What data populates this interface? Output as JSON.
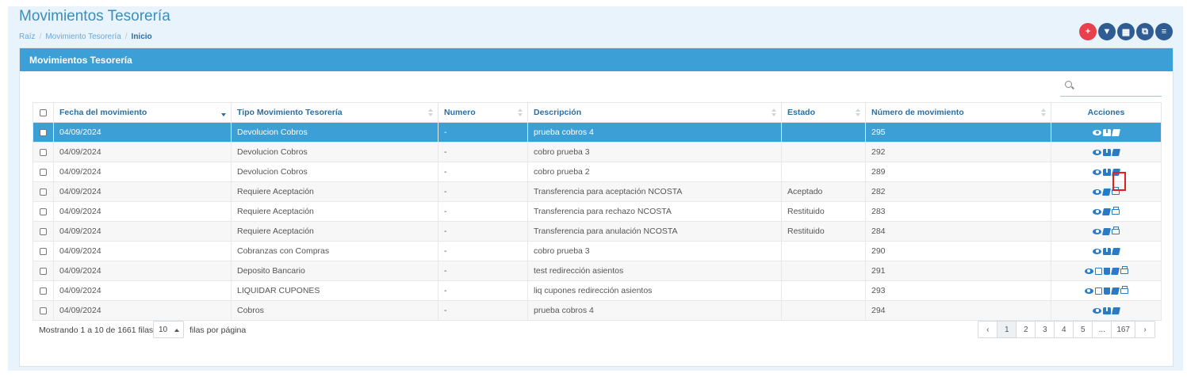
{
  "header": {
    "title": "Movimientos Tesorería",
    "breadcrumb": [
      "Raíz",
      "Movimiento Tesorería",
      "Inicio"
    ]
  },
  "toolbar": {
    "buttons": [
      {
        "icon": "plus-icon",
        "glyph": "+",
        "color": "#e8414d"
      },
      {
        "icon": "filter-icon",
        "glyph": "▼",
        "color": "#2f5d93"
      },
      {
        "icon": "columns-icon",
        "glyph": "▦",
        "color": "#2f5d93"
      },
      {
        "icon": "copy-icon",
        "glyph": "⧉",
        "color": "#2f5d93"
      },
      {
        "icon": "menu-icon",
        "glyph": "≡",
        "color": "#2f5d93"
      }
    ]
  },
  "panel": {
    "title": "Movimientos Tesorería",
    "search_placeholder": ""
  },
  "table": {
    "columns": [
      "Fecha del movimiento",
      "Tipo Movimiento Tesorería",
      "Numero",
      "Descripción",
      "Estado",
      "Número de movimiento",
      "Acciones"
    ],
    "rows": [
      {
        "fecha": "04/09/2024",
        "tipo": "Devolucion Cobros",
        "numero": "-",
        "descripcion": "prueba cobros 4",
        "estado": "",
        "nro": "295",
        "actions": [
          "eye",
          "binoculars",
          "book"
        ],
        "selected": true
      },
      {
        "fecha": "04/09/2024",
        "tipo": "Devolucion Cobros",
        "numero": "-",
        "descripcion": "cobro prueba 3",
        "estado": "",
        "nro": "292",
        "actions": [
          "eye",
          "binoculars",
          "book"
        ]
      },
      {
        "fecha": "04/09/2024",
        "tipo": "Devolucion Cobros",
        "numero": "-",
        "descripcion": "cobro prueba 2",
        "estado": "",
        "nro": "289",
        "actions": [
          "eye",
          "binoculars",
          "book"
        ]
      },
      {
        "fecha": "04/09/2024",
        "tipo": "Requiere Aceptación",
        "numero": "-",
        "descripcion": "Transferencia para aceptación NCOSTA",
        "estado": "Aceptado",
        "nro": "282",
        "actions": [
          "eye",
          "book",
          "print"
        ]
      },
      {
        "fecha": "04/09/2024",
        "tipo": "Requiere Aceptación",
        "numero": "-",
        "descripcion": "Transferencia para rechazo NCOSTA",
        "estado": "Restituido",
        "nro": "283",
        "actions": [
          "eye",
          "book",
          "print"
        ]
      },
      {
        "fecha": "04/09/2024",
        "tipo": "Requiere Aceptación",
        "numero": "-",
        "descripcion": "Transferencia para anulación NCOSTA",
        "estado": "Restituido",
        "nro": "284",
        "actions": [
          "eye",
          "book",
          "print"
        ]
      },
      {
        "fecha": "04/09/2024",
        "tipo": "Cobranzas con Compras",
        "numero": "-",
        "descripcion": "cobro prueba 3",
        "estado": "",
        "nro": "290",
        "actions": [
          "eye",
          "binoculars",
          "book"
        ]
      },
      {
        "fecha": "04/09/2024",
        "tipo": "Deposito Bancario",
        "numero": "-",
        "descripcion": "test redirección asientos",
        "estado": "",
        "nro": "291",
        "actions": [
          "eye",
          "edit",
          "trash",
          "book",
          "print"
        ]
      },
      {
        "fecha": "04/09/2024",
        "tipo": "LIQUIDAR CUPONES",
        "numero": "-",
        "descripcion": "liq cupones redirección asientos",
        "estado": "",
        "nro": "293",
        "actions": [
          "eye",
          "edit",
          "trash",
          "book",
          "print"
        ]
      },
      {
        "fecha": "04/09/2024",
        "tipo": "Cobros",
        "numero": "-",
        "descripcion": "prueba cobros 4",
        "estado": "",
        "nro": "294",
        "actions": [
          "eye",
          "binoculars",
          "book"
        ]
      }
    ]
  },
  "footer": {
    "info": "Mostrando 1 a 10 de 1661 filas",
    "page_size": "10",
    "page_size_label": "filas por página",
    "pages": [
      "‹",
      "1",
      "2",
      "3",
      "4",
      "5",
      "...",
      "167",
      "›"
    ],
    "active_page": "1"
  },
  "colors": {
    "accent": "#3c9fd6",
    "danger": "#e8414d",
    "dark": "#2f5d93"
  }
}
